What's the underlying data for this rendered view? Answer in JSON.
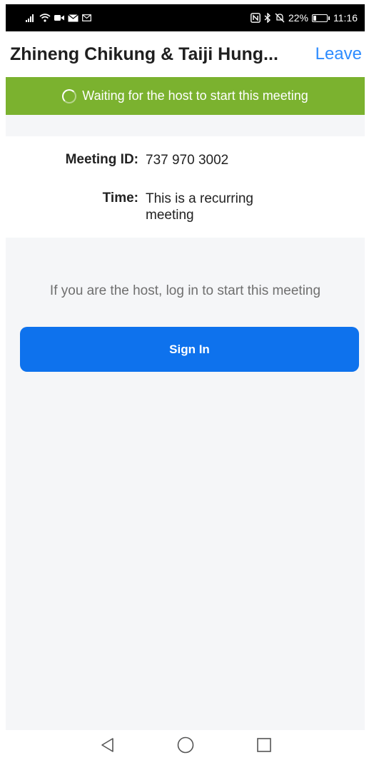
{
  "status_bar": {
    "left_icons": [
      "signal-icon",
      "wifi-icon",
      "video-icon",
      "mail-icon",
      "message-icon"
    ],
    "right_icons": [
      "nfc-icon",
      "bluetooth-icon",
      "mute-icon"
    ],
    "battery_percent": "22%",
    "battery_level": 0.22,
    "time": "11:16"
  },
  "header": {
    "title": "Zhineng Chikung & Taiji Hung...",
    "leave_label": "Leave"
  },
  "banner": {
    "text": "Waiting for the host to start this meeting",
    "color": "#7bb22f"
  },
  "meeting": {
    "id_label": "Meeting ID:",
    "id_value": "737 970 3002",
    "time_label": "Time:",
    "time_value": "This is a recurring meeting"
  },
  "host_prompt": "If you are the host, log in to start this meeting",
  "sign_in": {
    "label": "Sign In",
    "color": "#0e72ed"
  },
  "navigation": [
    "back-icon",
    "home-icon",
    "recents-icon"
  ]
}
